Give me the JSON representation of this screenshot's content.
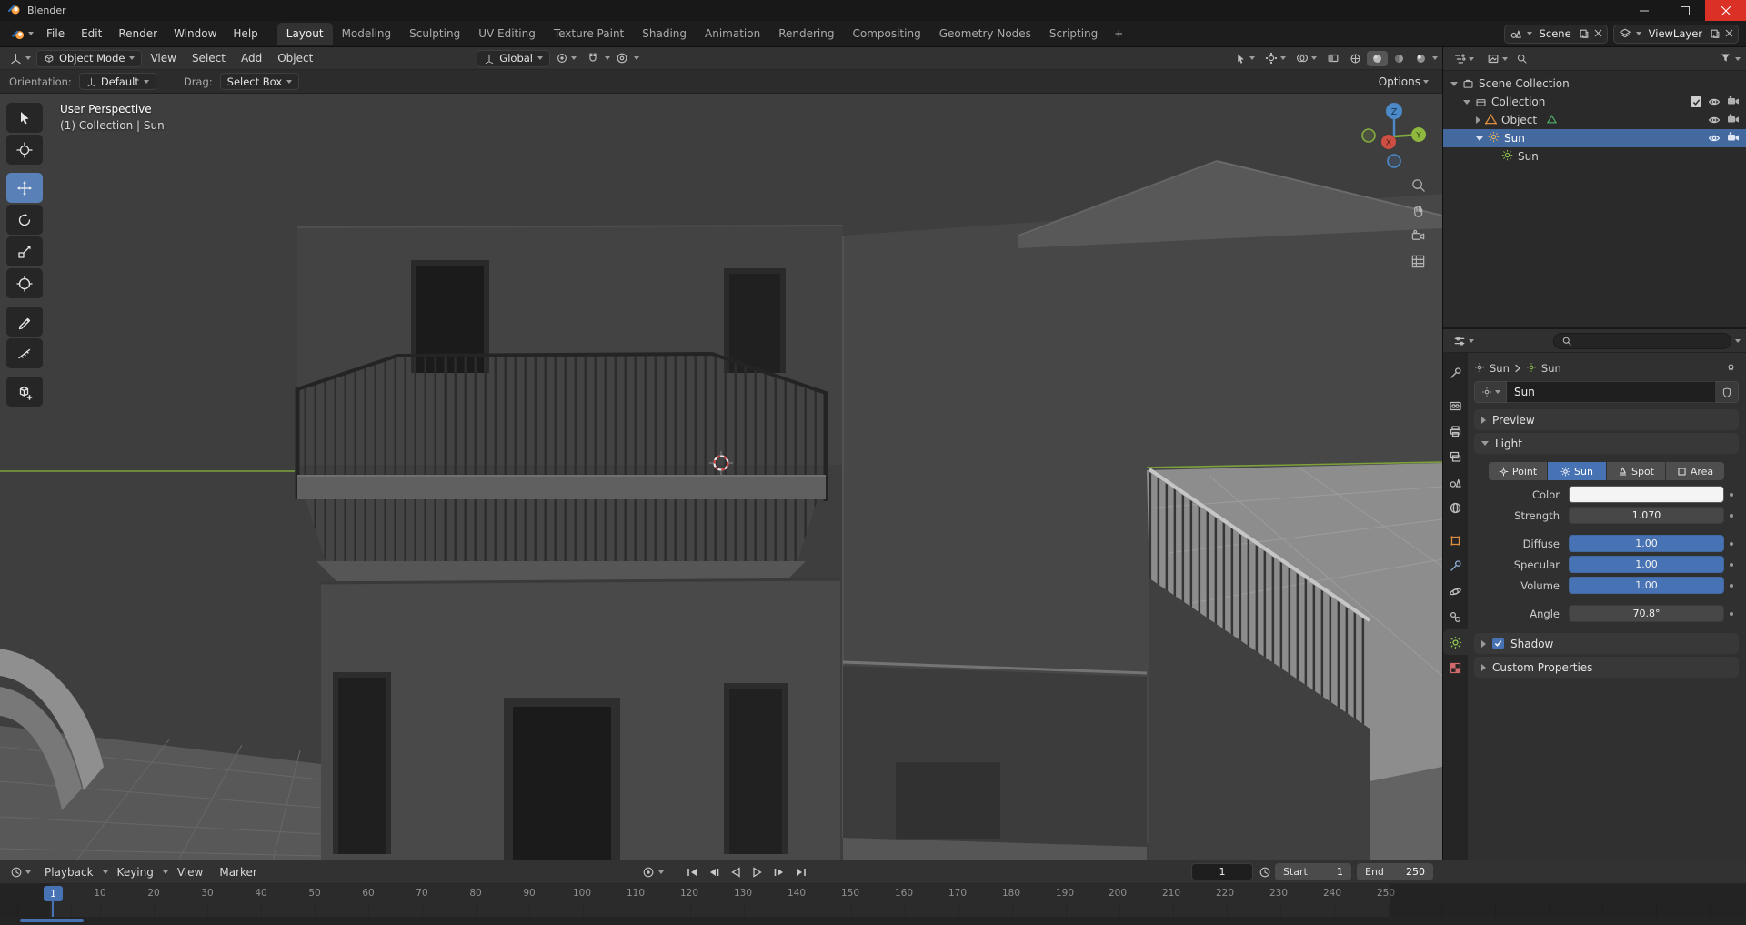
{
  "accent_color": "#4772b3",
  "selection_color": "#44699f",
  "window": {
    "title": "Blender"
  },
  "topbar": {
    "menus": [
      "File",
      "Edit",
      "Render",
      "Window",
      "Help"
    ],
    "workspaces": [
      "Layout",
      "Modeling",
      "Sculpting",
      "UV Editing",
      "Texture Paint",
      "Shading",
      "Animation",
      "Rendering",
      "Compositing",
      "Geometry Nodes",
      "Scripting"
    ],
    "active_workspace": "Layout",
    "add_workspace_label": "+",
    "scene_name": "Scene",
    "viewlayer_name": "ViewLayer"
  },
  "viewport": {
    "mode": "Object Mode",
    "menus": [
      "View",
      "Select",
      "Add",
      "Object"
    ],
    "transform_orientation": "Global",
    "tool_settings": {
      "orientation_label": "Orientation:",
      "orientation_value": "Default",
      "drag_label": "Drag:",
      "drag_value": "Select Box",
      "options_label": "Options"
    },
    "overlay": {
      "view_name": "User Perspective",
      "active_context": "(1) Collection | Sun"
    },
    "gizmo": {
      "z": "Z",
      "y": "Y",
      "x": "X"
    },
    "tools": [
      "Select Box",
      "Cursor",
      "Move",
      "Rotate",
      "Scale",
      "Transform",
      "Annotate",
      "Measure",
      "Add Cube"
    ],
    "active_tool": "Move"
  },
  "outliner": {
    "rows": [
      {
        "label": "Scene Collection"
      },
      {
        "label": "Collection"
      },
      {
        "label": "Object"
      },
      {
        "label": "Sun"
      },
      {
        "label": "Sun"
      }
    ],
    "selected_row": "Sun"
  },
  "properties": {
    "breadcrumb": {
      "object_name": "Sun",
      "data_name": "Sun"
    },
    "name_field": "Sun",
    "panels": {
      "preview": "Preview",
      "light": "Light",
      "shadow": "Shadow",
      "custom_properties": "Custom Properties"
    },
    "light": {
      "types": [
        "Point",
        "Sun",
        "Spot",
        "Area"
      ],
      "active_type": "Sun",
      "color_label": "Color",
      "strength_label": "Strength",
      "strength_value": "1.070",
      "diffuse_label": "Diffuse",
      "diffuse_value": "1.00",
      "specular_label": "Specular",
      "specular_value": "1.00",
      "volume_label": "Volume",
      "volume_value": "1.00",
      "angle_label": "Angle",
      "angle_value": "70.8°",
      "shadow_enabled": true
    }
  },
  "timeline": {
    "menus": [
      "Playback",
      "Keying",
      "View",
      "Marker"
    ],
    "current_frame": "1",
    "start_label": "Start",
    "start_value": "1",
    "end_label": "End",
    "end_value": "250",
    "ruler_frames": [
      "10",
      "20",
      "30",
      "40",
      "50",
      "60",
      "70",
      "80",
      "90",
      "100",
      "110",
      "120",
      "130",
      "140",
      "150",
      "160",
      "170",
      "180",
      "190",
      "200",
      "210",
      "220",
      "230",
      "240",
      "250"
    ]
  }
}
